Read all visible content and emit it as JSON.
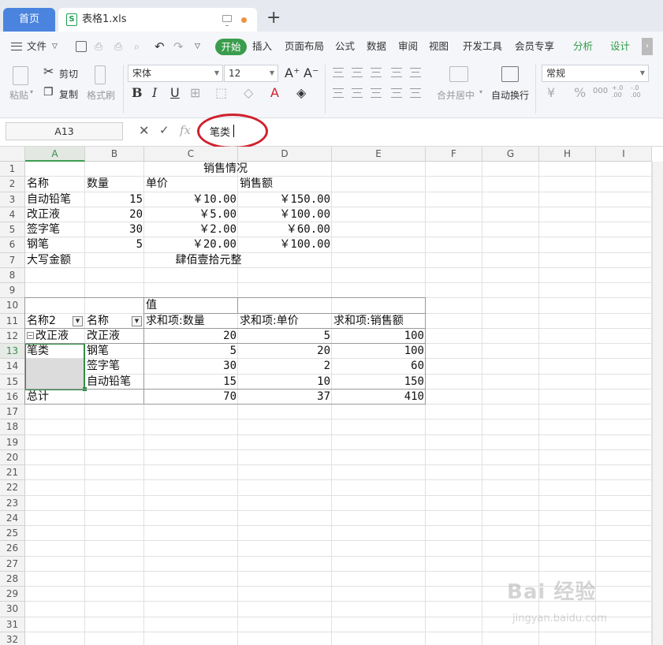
{
  "tabs": {
    "home": "首页",
    "file": "表格1.xls",
    "add": "+"
  },
  "menu": {
    "file": "文件",
    "items": [
      "开始",
      "插入",
      "页面布局",
      "公式",
      "数据",
      "审阅",
      "视图",
      "开发工具",
      "会员专享"
    ],
    "extra": [
      "分析",
      "设计"
    ]
  },
  "ribbon": {
    "paste": "粘贴",
    "cut": "剪切",
    "copy": "复制",
    "format_painter": "格式刷",
    "font_name": "宋体",
    "font_size": "12",
    "merge_center": "合并居中",
    "wrap_text": "自动换行",
    "number_format": "常规",
    "bold": "B",
    "italic": "I",
    "underline": "U",
    "font_inc": "A⁺",
    "font_dec": "A⁻",
    "currency": "¥",
    "percent": "%",
    "thousands": "000",
    "dec_inc": "+.0\n.00",
    "dec_dec": "-.0\n.00"
  },
  "formula_bar": {
    "cell_ref": "A13",
    "fx": "fx",
    "content": "笔类"
  },
  "columns": [
    "A",
    "B",
    "C",
    "D",
    "E",
    "F",
    "G",
    "H",
    "I"
  ],
  "rows": [
    "1",
    "2",
    "3",
    "4",
    "5",
    "6",
    "7",
    "8",
    "9",
    "10",
    "11",
    "12",
    "13",
    "14",
    "15",
    "16",
    "17",
    "18",
    "19",
    "20",
    "21",
    "22",
    "23",
    "24",
    "25",
    "26",
    "27",
    "28",
    "29",
    "30",
    "31",
    "32"
  ],
  "sheet": {
    "title": "销售情况",
    "headers": [
      "名称",
      "数量",
      "单价",
      "销售额"
    ],
    "data": [
      [
        "自动铅笔",
        "15",
        "￥10.00",
        "￥150.00"
      ],
      [
        "改正液",
        "20",
        "￥5.00",
        "￥100.00"
      ],
      [
        "签字笔",
        "30",
        "￥2.00",
        "￥60.00"
      ],
      [
        "钢笔",
        "5",
        "￥20.00",
        "￥100.00"
      ]
    ],
    "amount_label": "大写金额",
    "amount_text": "肆佰壹拾元整"
  },
  "pivot": {
    "value_label": "值",
    "headers": [
      "名称2",
      "名称",
      "求和项:数量",
      "求和项:单价",
      "求和项:销售额"
    ],
    "rows": [
      [
        "改正液",
        "改正液",
        "20",
        "5",
        "100"
      ],
      [
        "笔类",
        "钢笔",
        "5",
        "20",
        "100"
      ],
      [
        "",
        "签字笔",
        "30",
        "2",
        "60"
      ],
      [
        "",
        "自动铅笔",
        "15",
        "10",
        "150"
      ]
    ],
    "total": [
      "总计",
      "",
      "70",
      "37",
      "410"
    ]
  },
  "watermark": {
    "main": "Bai 经验",
    "sub": "jingyan.baidu.com"
  }
}
